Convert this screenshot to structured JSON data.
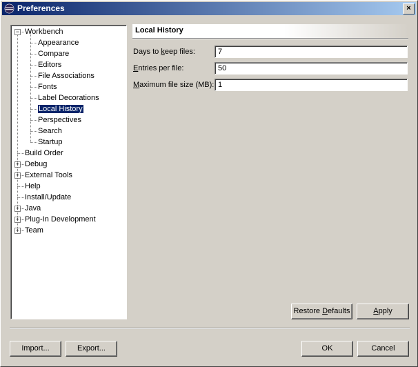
{
  "window": {
    "title": "Preferences",
    "close_glyph": "×"
  },
  "tree": [
    {
      "label": "Workbench",
      "level": 0,
      "expander": "−"
    },
    {
      "label": "Appearance",
      "level": 1
    },
    {
      "label": "Compare",
      "level": 1
    },
    {
      "label": "Editors",
      "level": 1
    },
    {
      "label": "File Associations",
      "level": 1
    },
    {
      "label": "Fonts",
      "level": 1
    },
    {
      "label": "Label Decorations",
      "level": 1
    },
    {
      "label": "Local History",
      "level": 1,
      "selected": true
    },
    {
      "label": "Perspectives",
      "level": 1
    },
    {
      "label": "Search",
      "level": 1
    },
    {
      "label": "Startup",
      "level": 1
    },
    {
      "label": "Build Order",
      "level": 0
    },
    {
      "label": "Debug",
      "level": 0,
      "expander": "+"
    },
    {
      "label": "External Tools",
      "level": 0,
      "expander": "+"
    },
    {
      "label": "Help",
      "level": 0
    },
    {
      "label": "Install/Update",
      "level": 0
    },
    {
      "label": "Java",
      "level": 0,
      "expander": "+"
    },
    {
      "label": "Plug-In Development",
      "level": 0,
      "expander": "+"
    },
    {
      "label": "Team",
      "level": 0,
      "expander": "+"
    }
  ],
  "page": {
    "title": "Local History",
    "fields": [
      {
        "pre": "Days to ",
        "mn": "k",
        "post": "eep files:",
        "value": "7"
      },
      {
        "pre": "",
        "mn": "E",
        "post": "ntries per file:",
        "value": "50"
      },
      {
        "pre": "",
        "mn": "M",
        "post": "aximum file size (MB):",
        "value": "1"
      }
    ],
    "restore_defaults": {
      "pre": "Restore ",
      "mn": "D",
      "post": "efaults"
    },
    "apply": {
      "pre": "",
      "mn": "A",
      "post": "pply"
    }
  },
  "footer": {
    "import": "Import...",
    "export": "Export...",
    "ok": "OK",
    "cancel": "Cancel"
  },
  "icons": {
    "title": "eclipse-icon"
  }
}
